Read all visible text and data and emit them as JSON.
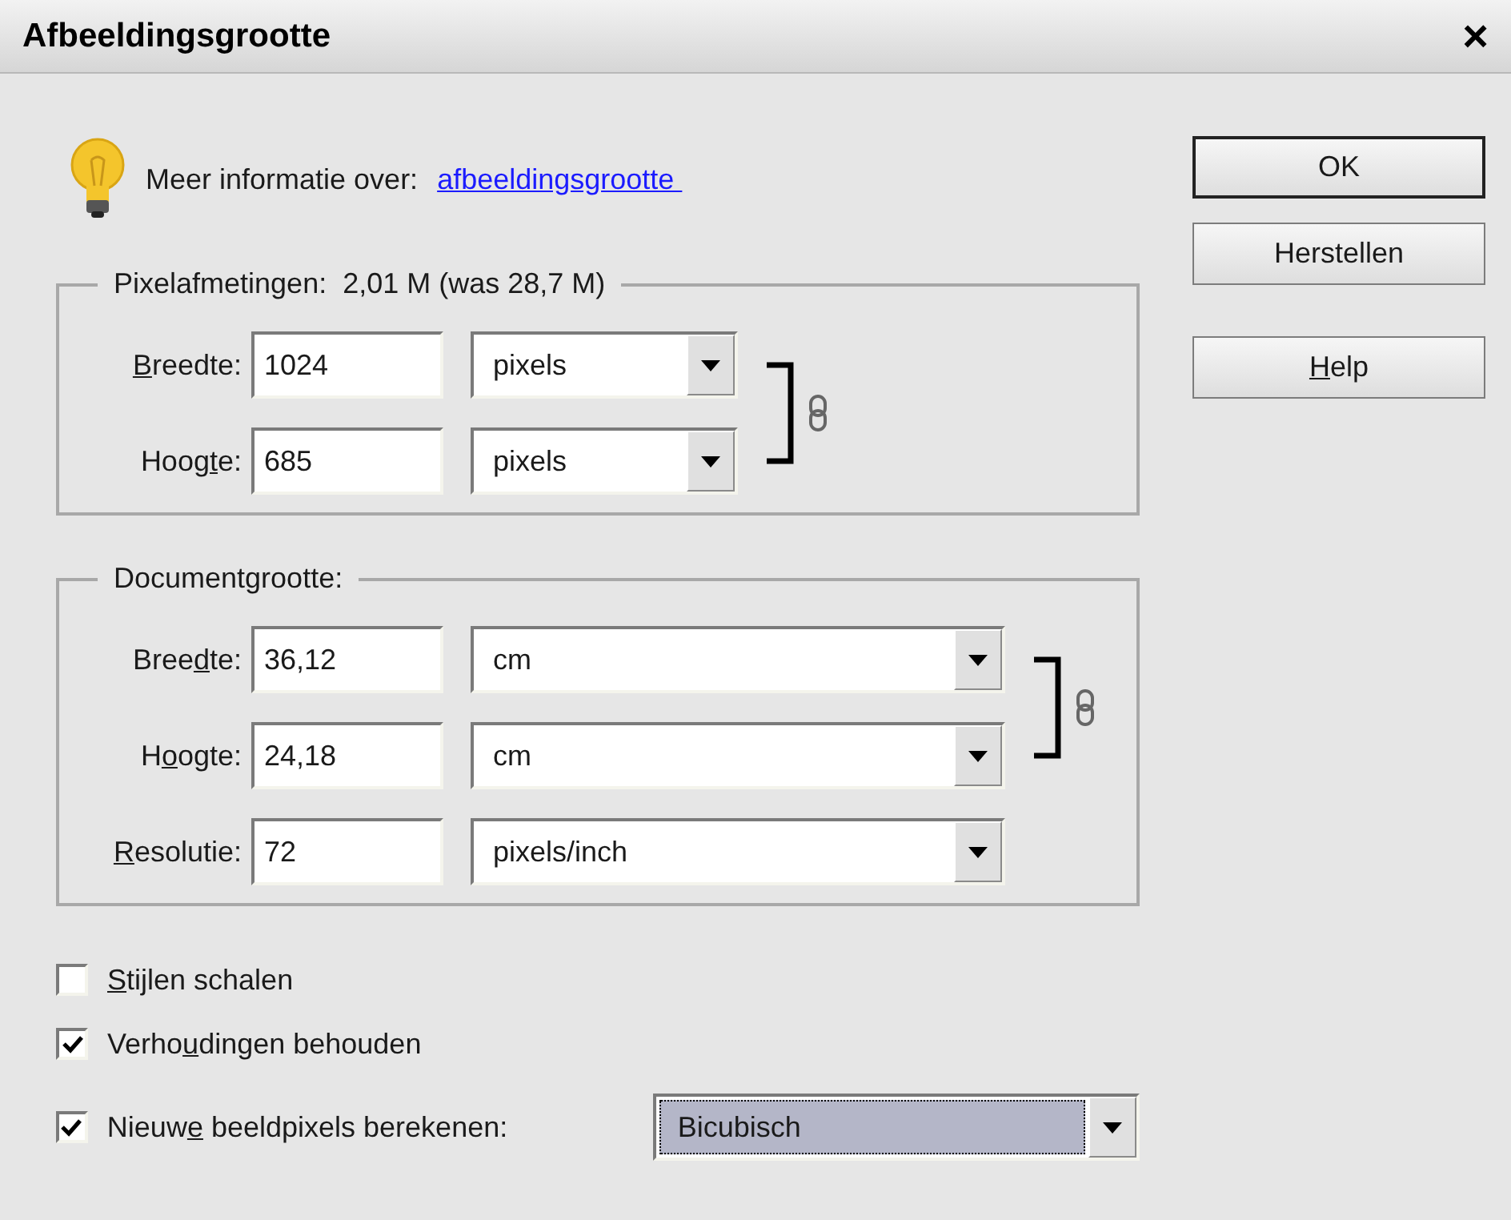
{
  "window": {
    "title": "Afbeeldingsgrootte",
    "close": "×"
  },
  "info": {
    "text": "Meer informatie over:",
    "link": "afbeeldingsgrootte "
  },
  "pixel_dimensions": {
    "legend": "Pixelafmetingen:",
    "size_info": "2,01 M (was 28,7 M)",
    "constrained": true,
    "fields": [
      {
        "label": {
          "key": "B",
          "post": "reedte:"
        },
        "value": "1024",
        "unit": "pixels"
      },
      {
        "label": {
          "pre": "Hoog",
          "key": "t",
          "post": "e:"
        },
        "value": "685",
        "unit": "pixels"
      }
    ]
  },
  "document_size": {
    "legend": "Documentgrootte:",
    "constrained": true,
    "fields": [
      {
        "label": {
          "pre": "Bree",
          "key": "d",
          "post": "te:"
        },
        "value": "36,12",
        "unit": "cm"
      },
      {
        "label": {
          "pre": "H",
          "key": "o",
          "post": "ogte:"
        },
        "value": "24,18",
        "unit": "cm"
      },
      {
        "label": {
          "key": "R",
          "post": "esolutie:"
        },
        "value": "72",
        "unit": "pixels/inch"
      }
    ]
  },
  "options": [
    {
      "label": {
        "key": "S",
        "post": "tijlen schalen"
      },
      "checked": false
    },
    {
      "label": {
        "pre": "Verho",
        "key": "u",
        "post": "dingen behouden"
      },
      "checked": true
    },
    {
      "label": {
        "pre": "Nieuw",
        "key": "e",
        "post": " beeldpixels berekenen:"
      },
      "checked": true,
      "method": {
        "value": "Bicubisch",
        "focused": true
      }
    }
  ],
  "buttons": [
    {
      "label": {
        "post": "OK"
      },
      "default": true
    },
    {
      "label": {
        "post": "Herstellen"
      },
      "default": false
    },
    {
      "label": {
        "key": "H",
        "post": "elp"
      },
      "default": false
    }
  ]
}
